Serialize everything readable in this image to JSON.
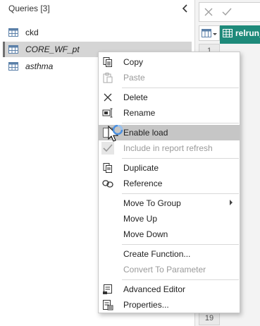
{
  "queries": {
    "header": "Queries [3]",
    "items": [
      {
        "label": "ckd",
        "italic": false,
        "selected": false
      },
      {
        "label": "CORE_WF_pt",
        "italic": true,
        "selected": true
      },
      {
        "label": "asthma",
        "italic": true,
        "selected": false
      }
    ]
  },
  "editor": {
    "column_header": "relrun_",
    "row_numbers": [
      "1",
      "19"
    ]
  },
  "context_menu": {
    "items": [
      {
        "label": "Copy",
        "icon": "copy-icon",
        "disabled": false
      },
      {
        "label": "Paste",
        "icon": "paste-icon",
        "disabled": true
      },
      {
        "label": "Delete",
        "icon": "delete-icon",
        "disabled": false
      },
      {
        "label": "Rename",
        "icon": "rename-icon",
        "disabled": false
      },
      {
        "label": "Enable load",
        "icon": "checkbox-icon",
        "disabled": false,
        "highlighted": true
      },
      {
        "label": "Include in report refresh",
        "icon": "checkmark-icon",
        "disabled": true
      },
      {
        "label": "Duplicate",
        "icon": "duplicate-icon",
        "disabled": false
      },
      {
        "label": "Reference",
        "icon": "reference-icon",
        "disabled": false
      },
      {
        "label": "Move To Group",
        "icon": "",
        "disabled": false,
        "submenu": true
      },
      {
        "label": "Move Up",
        "icon": "",
        "disabled": false
      },
      {
        "label": "Move Down",
        "icon": "",
        "disabled": false
      },
      {
        "label": "Create Function...",
        "icon": "",
        "disabled": false
      },
      {
        "label": "Convert To Parameter",
        "icon": "",
        "disabled": true
      },
      {
        "label": "Advanced Editor",
        "icon": "advanced-editor-icon",
        "disabled": false
      },
      {
        "label": "Properties...",
        "icon": "properties-icon",
        "disabled": false
      }
    ]
  },
  "colors": {
    "accent_teal": "#1e8a7a",
    "highlight": "#c6c6c6",
    "selected_query": "#d5d5d5",
    "disabled_text": "#9a9a9a"
  }
}
